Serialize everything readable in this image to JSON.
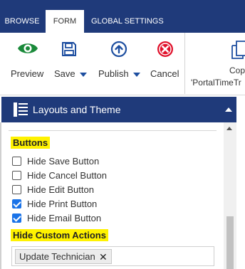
{
  "tabs": [
    {
      "label": "BROWSE",
      "active": false
    },
    {
      "label": "FORM",
      "active": true
    },
    {
      "label": "GLOBAL SETTINGS",
      "active": false
    }
  ],
  "ribbon": {
    "preview": {
      "label": "Preview",
      "icon": "eye-icon",
      "color": "#1a8a3a"
    },
    "save": {
      "label": "Save",
      "icon": "floppy-disk-icon",
      "color": "#1e4fa0"
    },
    "publish": {
      "label": "Publish",
      "icon": "upload-icon",
      "color": "#1e4fa0"
    },
    "cancel": {
      "label": "Cancel",
      "icon": "cancel-icon",
      "color": "#e0102a"
    },
    "copy": {
      "label": "Cop",
      "sublabel": "'PortalTimeTr",
      "icon": "copy-icon"
    }
  },
  "panel": {
    "title": "Layouts and Theme",
    "buttons_label": "Buttons",
    "checkboxes": [
      {
        "label": "Hide Save Button",
        "checked": false
      },
      {
        "label": "Hide Cancel Button",
        "checked": false
      },
      {
        "label": "Hide Edit Button",
        "checked": false
      },
      {
        "label": "Hide Print Button",
        "checked": true
      },
      {
        "label": "Hide Email Button",
        "checked": true
      }
    ],
    "custom_actions_label": "Hide Custom Actions",
    "custom_actions": [
      {
        "label": "Update Technician",
        "remove_symbol": "✕"
      }
    ]
  },
  "colors": {
    "header_blue": "#1f3a7a",
    "highlight": "#fff200",
    "checkbox_blue": "#1a73e8"
  }
}
